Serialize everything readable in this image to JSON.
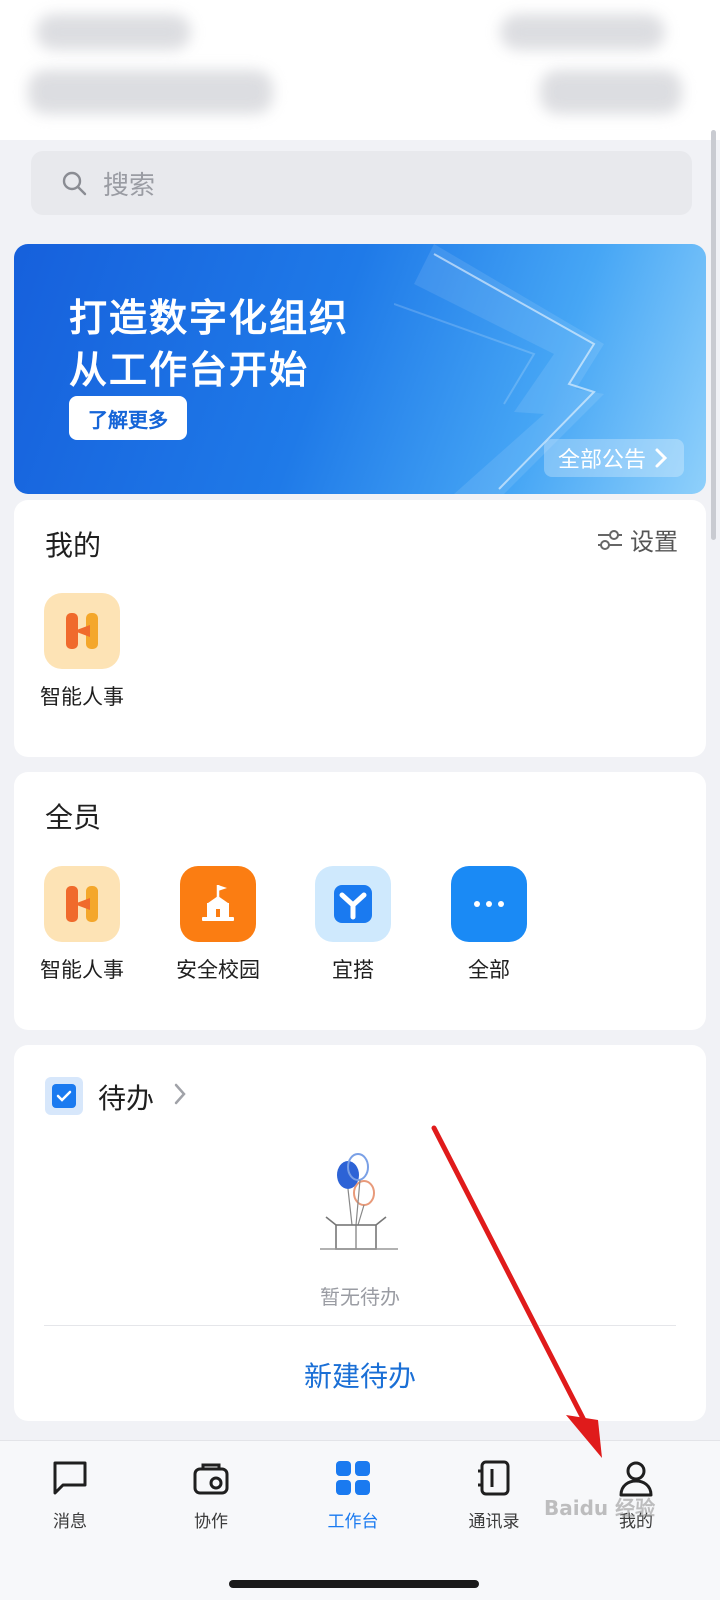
{
  "search": {
    "placeholder": "搜索"
  },
  "banner": {
    "line1": "打造数字化组织",
    "line2": "从工作台开始",
    "button": "了解更多",
    "all_notices": "全部公告"
  },
  "mine": {
    "title": "我的",
    "settings": "设置",
    "apps": [
      {
        "label": "智能人事",
        "icon": "smart-hr-icon"
      }
    ]
  },
  "all_members": {
    "title": "全员",
    "apps": [
      {
        "label": "智能人事",
        "icon": "smart-hr-icon"
      },
      {
        "label": "安全校园",
        "icon": "safe-campus-icon"
      },
      {
        "label": "宜搭",
        "icon": "yida-icon"
      },
      {
        "label": "全部",
        "icon": "more-dots-icon"
      }
    ]
  },
  "todo": {
    "title": "待办",
    "empty": "暂无待办",
    "new": "新建待办"
  },
  "tabbar": {
    "items": [
      {
        "label": "消息",
        "icon": "message-icon"
      },
      {
        "label": "协作",
        "icon": "collaboration-icon"
      },
      {
        "label": "工作台",
        "icon": "workbench-icon",
        "active": true
      },
      {
        "label": "通讯录",
        "icon": "contacts-icon"
      },
      {
        "label": "我的",
        "icon": "profile-icon"
      }
    ]
  },
  "colors": {
    "accent": "#1a7af0",
    "link": "#1a6fd6",
    "banner": "#1f7ae8",
    "annotation_arrow": "#e01b1b"
  },
  "watermark": "Baidu 经验"
}
